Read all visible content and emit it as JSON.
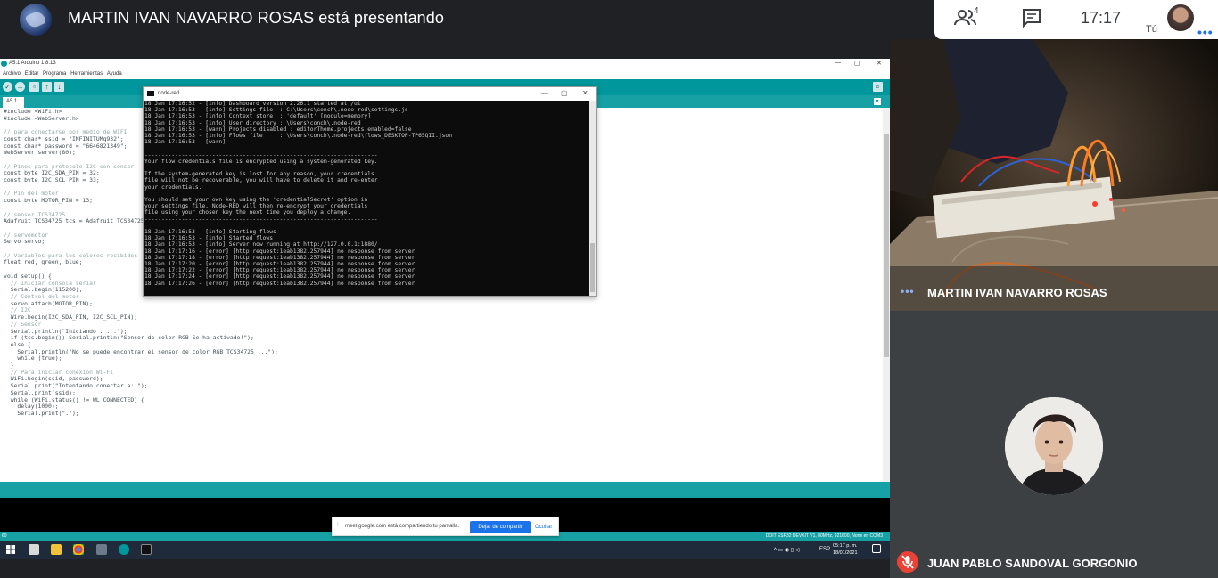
{
  "meet": {
    "presenting_title": "MARTIN IVAN NAVARRO ROSAS está presentando",
    "people_count": "4",
    "clock": "17:17",
    "self_label": "Tú",
    "more_dots": "•••"
  },
  "arduino": {
    "window_title": "A5.1 Arduino 1.8.13",
    "window_controls": [
      "—",
      "▢",
      "✕"
    ],
    "menu": [
      "Archivo",
      "Editar",
      "Programa",
      "Herramientas",
      "Ayuda"
    ],
    "tab_label": "A5.1",
    "code_lines": [
      "#include <WiFi.h>",
      "#include <WebServer.h>",
      "",
      "// para conectarse por medio de WIFI",
      "const char* ssid = \"INFINITUMq932\";",
      "const char* password = \"6646821349\";",
      "WebServer server(80);",
      "",
      "// Pines para protocolo I2C con sensor",
      "const byte I2C_SDA_PIN = 32;",
      "const byte I2C_SCL_PIN = 33;",
      "",
      "// Pin del motor",
      "const byte MOTOR_PIN = 13;",
      "",
      "// sensor TCS34725",
      "Adafruit_TCS34725 tcs = Adafruit_TCS34725(TCS34725_INTEGRATIONTIME_50MS);",
      "",
      "// servomotor",
      "Servo servo;",
      "",
      "// Variables para los colores recibidos",
      "float red, green, blue;",
      "",
      "void setup() {",
      "  // Iniciar consola serial",
      "  Serial.begin(115200);",
      "  // Control del motor",
      "  servo.attach(MOTOR_PIN);",
      "  // I2C",
      "  Wire.begin(I2C_SDA_PIN, I2C_SCL_PIN);",
      "  // Sensor",
      "  Serial.println(\"Iniciando . . .\");",
      "  if (tcs.begin()) Serial.println(\"Sensor de color RGB Se ha activado!\");",
      "  else {",
      "    Serial.println(\"No se puede encontrar el sensor de color RGB TCS34725 ...\");",
      "    while (true);",
      "  }",
      "  // Para iniciar conexion Wi-Fi",
      "  WiFi.begin(ssid, password);",
      "  Serial.print(\"Intentando conectar a: \");",
      "  Serial.print(ssid);",
      "  while (WiFi.status() != WL_CONNECTED) {",
      "    delay(1000);",
      "    Serial.print(\".\");"
    ],
    "status_line": "60",
    "board_info": "DOIT ESP32 DEVKIT V1, 80MHz, 921600, None en COM3"
  },
  "nodered": {
    "window_title": "node-red",
    "window_controls": [
      "—",
      "▢",
      "✕"
    ],
    "console_lines": [
      "18 Jan 17:16:52 - [info] Dashboard version 2.26.1 started at /ui",
      "18 Jan 17:16:53 - [info] Settings file  : C:\\Users\\conch\\.node-red\\settings.js",
      "18 Jan 17:16:53 - [info] Context store  : 'default' [module=memory]",
      "18 Jan 17:16:53 - [info] User directory : \\Users\\conch\\.node-red",
      "18 Jan 17:16:53 - [warn] Projects disabled : editorTheme.projects.enabled=false",
      "18 Jan 17:16:53 - [info] Flows file     : \\Users\\conch\\.node-red\\flows_DESKTOP-TP65QII.json",
      "18 Jan 17:16:53 - [warn]",
      "",
      "---------------------------------------------------------------------",
      "Your flow credentials file is encrypted using a system-generated key.",
      "",
      "If the system-generated key is lost for any reason, your credentials",
      "file will not be recoverable, you will have to delete it and re-enter",
      "your credentials.",
      "",
      "You should set your own key using the 'credentialSecret' option in",
      "your settings file. Node-RED will then re-encrypt your credentials",
      "file using your chosen key the next time you deploy a change.",
      "---------------------------------------------------------------------",
      "",
      "18 Jan 17:16:53 - [info] Starting flows",
      "18 Jan 17:16:53 - [info] Started flows",
      "18 Jan 17:16:53 - [info] Server now running at http://127.0.0.1:1880/",
      "18 Jan 17:17:16 - [error] [http request:1eab1382.257944] no response from server",
      "18 Jan 17:17:18 - [error] [http request:1eab1382.257944] no response from server",
      "18 Jan 17:17:20 - [error] [http request:1eab1382.257944] no response from server",
      "18 Jan 17:17:22 - [error] [http request:1eab1382.257944] no response from server",
      "18 Jan 17:17:24 - [error] [http request:1eab1382.257944] no response from server",
      "18 Jan 17:17:26 - [error] [http request:1eab1382.257944] no response from server"
    ]
  },
  "share_notice": {
    "grip": "⁞",
    "text": "meet.google.com está compartiendo tu pantalla.",
    "stop_label": "Dejar de compartir",
    "hide_label": "Ocultar"
  },
  "taskbar": {
    "lang": "ESP",
    "time": "05:17 p. m.",
    "date": "18/01/2021",
    "sys_icons": "^ ▭ ◉ ▯ ◁"
  },
  "participants": [
    {
      "name": "MARTIN IVAN NAVARRO ROSAS",
      "speaking": true
    },
    {
      "name": "JUAN PABLO SANDOVAL GORGONIO",
      "muted": true
    }
  ],
  "colors": {
    "arduino_teal": "#00979c",
    "meet_bg": "#202124",
    "meet_blue": "#1a73e8",
    "mute_red": "#ea4335"
  }
}
